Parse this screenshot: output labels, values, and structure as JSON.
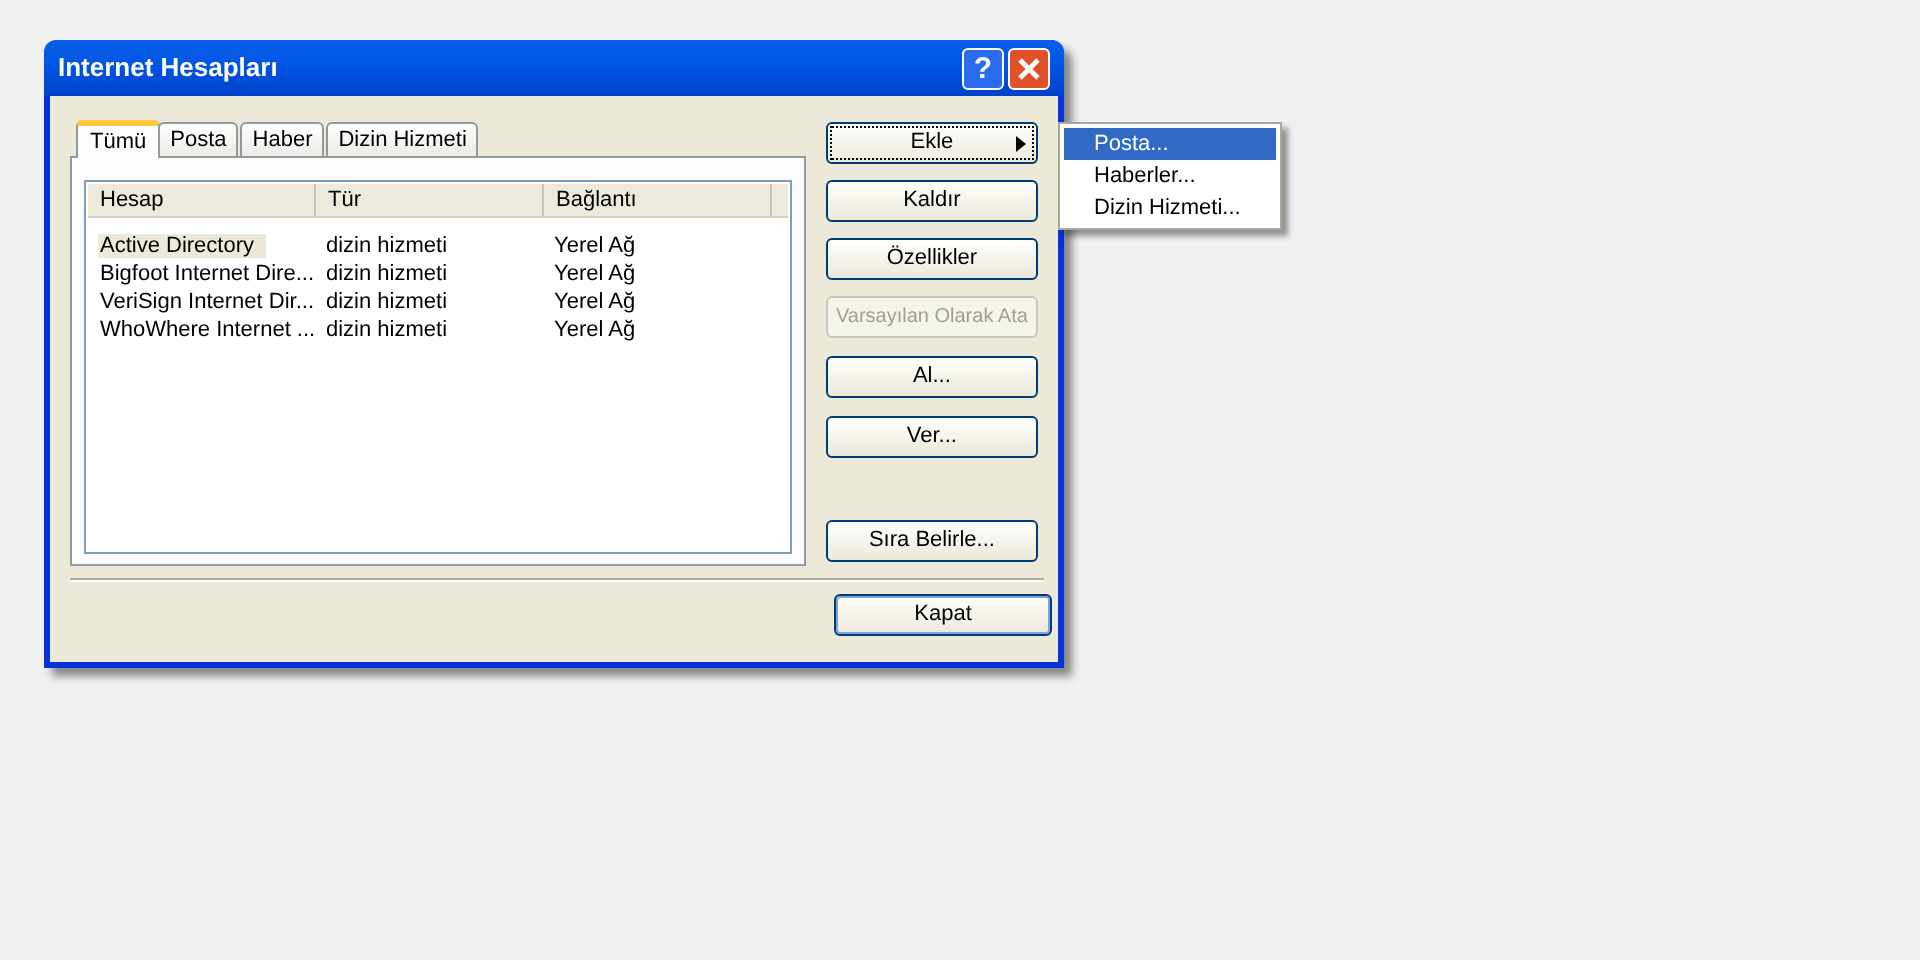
{
  "window": {
    "title": "Internet Hesapları",
    "help_button": "?"
  },
  "tabs": [
    {
      "label": "Tümü",
      "selected": true
    },
    {
      "label": "Posta",
      "selected": false
    },
    {
      "label": "Haber",
      "selected": false
    },
    {
      "label": "Dizin Hizmeti",
      "selected": false
    }
  ],
  "table": {
    "columns": [
      "Hesap",
      "Tür",
      "Bağlantı"
    ],
    "rows": [
      {
        "cells": [
          "Active Directory",
          "dizin hizmeti",
          "Yerel Ağ"
        ],
        "selected": true
      },
      {
        "cells": [
          "Bigfoot Internet Dire...",
          "dizin hizmeti",
          "Yerel Ağ"
        ],
        "selected": false
      },
      {
        "cells": [
          "VeriSign Internet Dir...",
          "dizin hizmeti",
          "Yerel Ağ"
        ],
        "selected": false
      },
      {
        "cells": [
          "WhoWhere Internet ...",
          "dizin hizmeti",
          "Yerel Ağ"
        ],
        "selected": false
      }
    ]
  },
  "buttons": [
    {
      "label": "Ekle",
      "disabled": false,
      "focused": true,
      "submenu": true
    },
    {
      "label": "Kaldır",
      "disabled": false,
      "focused": false,
      "submenu": false
    },
    {
      "label": "Özellikler",
      "disabled": false,
      "focused": false,
      "submenu": false
    },
    {
      "label": "Varsayılan Olarak Ata",
      "disabled": true,
      "focused": false,
      "submenu": false
    },
    {
      "label": "Al...",
      "disabled": false,
      "focused": false,
      "submenu": false
    },
    {
      "label": "Ver...",
      "disabled": false,
      "focused": false,
      "submenu": false
    },
    {
      "label": "Sıra Belirle...",
      "disabled": false,
      "focused": false,
      "submenu": false
    }
  ],
  "close_button": {
    "label": "Kapat"
  },
  "submenu": {
    "items": [
      {
        "label": "Posta...",
        "selected": true
      },
      {
        "label": "Haberler...",
        "selected": false
      },
      {
        "label": "Dizin Hizmeti...",
        "selected": false
      }
    ]
  }
}
